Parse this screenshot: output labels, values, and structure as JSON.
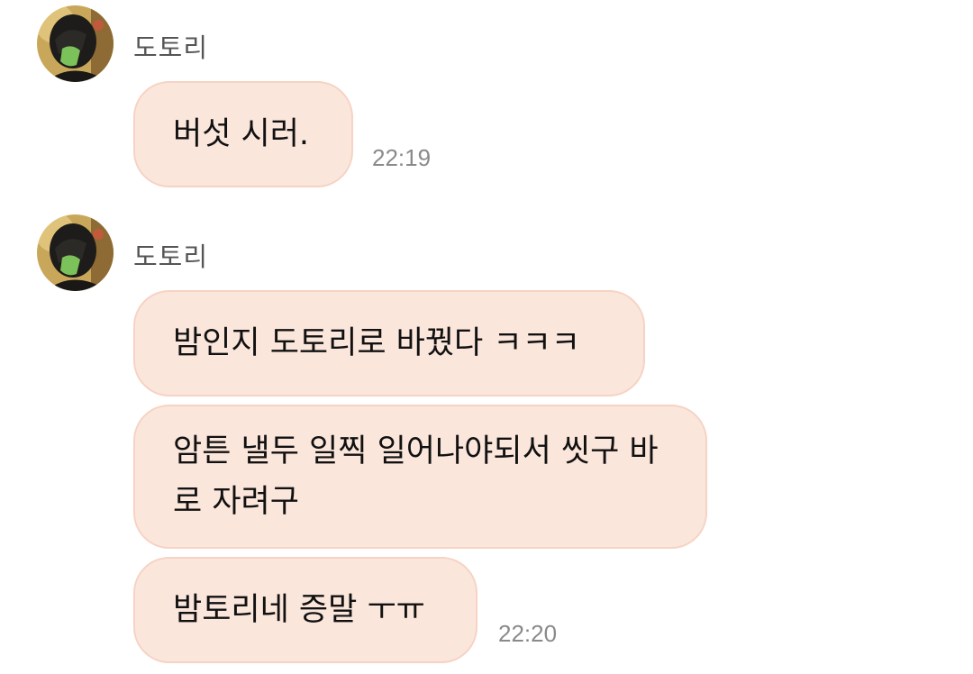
{
  "messages": [
    {
      "sender": "도토리",
      "avatar_icon": "profile-avatar",
      "bubbles": [
        "버섯 시러."
      ],
      "time": "22:19"
    },
    {
      "sender": "도토리",
      "avatar_icon": "profile-avatar",
      "bubbles": [
        "밤인지 도토리로 바꿨다 ㅋㅋㅋ",
        "암튼 낼두 일찍 일어나야되서 씻구 바로 자려구",
        "밤토리네 증말 ㅜㅠ"
      ],
      "time": "22:20"
    }
  ],
  "colors": {
    "bubble_bg": "#fbe6dc",
    "bubble_border": "#f6d3c3",
    "sender_text": "#555555",
    "time_text": "#8a8a8a"
  }
}
